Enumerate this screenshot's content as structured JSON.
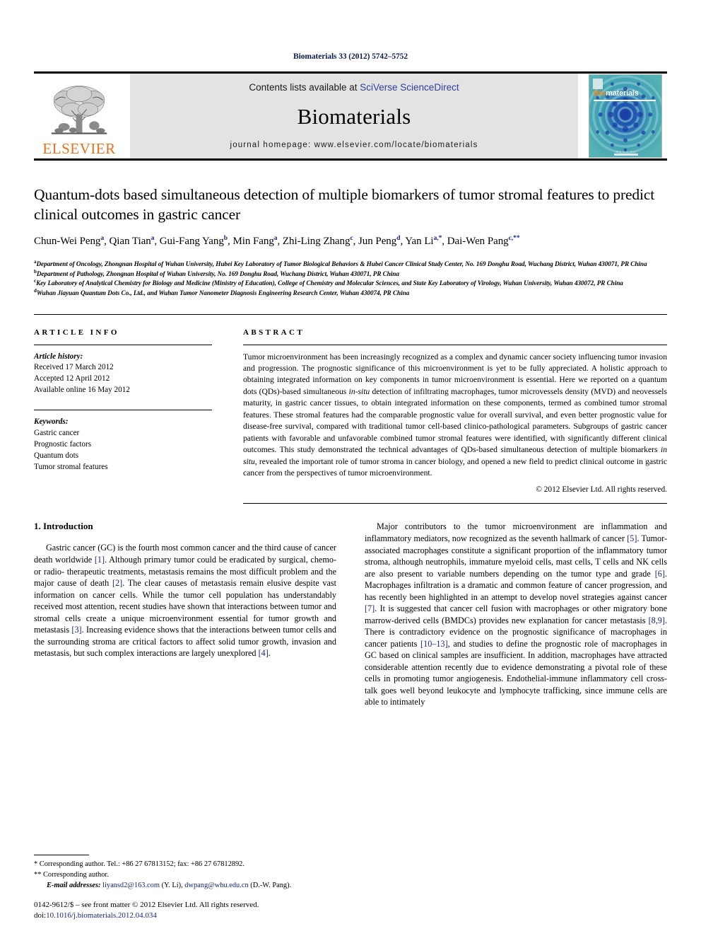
{
  "running_head": "Biomaterials 33 (2012) 5742–5752",
  "masthead": {
    "publisher_name": "ELSEVIER",
    "contents_prefix": "Contents lists available at ",
    "contents_link": "SciVerse ScienceDirect",
    "journal_name": "Biomaterials",
    "homepage": "journal homepage: www.elsevier.com/locate/biomaterials",
    "cover": {
      "title_part1": "Bio",
      "title_part2": "materials",
      "footer_text": "ISSN 0142-9612",
      "bg_color": "#3aa0a8",
      "accent_color": "#f0861e"
    },
    "brand_color": "#E9711C",
    "link_color": "#2c3f9e"
  },
  "article": {
    "title": "Quantum-dots based simultaneous detection of multiple biomarkers of tumor stromal features to predict clinical outcomes in gastric cancer",
    "authors": [
      {
        "name": "Chun-Wei Peng",
        "marks": "a"
      },
      {
        "name": "Qian Tian",
        "marks": "a"
      },
      {
        "name": "Gui-Fang Yang",
        "marks": "b"
      },
      {
        "name": "Min Fang",
        "marks": "a"
      },
      {
        "name": "Zhi-Ling Zhang",
        "marks": "c"
      },
      {
        "name": "Jun Peng",
        "marks": "d"
      },
      {
        "name": "Yan Li",
        "marks": "a,*"
      },
      {
        "name": "Dai-Wen Pang",
        "marks": "c,**"
      }
    ],
    "affiliations": [
      {
        "mark": "a",
        "text": "Department of Oncology, Zhongnan Hospital of Wuhan University, Hubei Key Laboratory of Tumor Biological Behaviors & Hubei Cancer Clinical Study Center, No. 169 Donghu Road, Wuchang District, Wuhan 430071, PR China"
      },
      {
        "mark": "b",
        "text": "Department of Pathology, Zhongnan Hospital of Wuhan University, No. 169 Donghu Road, Wuchang District, Wuhan 430071, PR China"
      },
      {
        "mark": "c",
        "text": "Key Laboratory of Analytical Chemistry for Biology and Medicine (Ministry of Education), College of Chemistry and Molecular Sciences, and State Key Laboratory of Virology, Wuhan University, Wuhan 430072, PR China"
      },
      {
        "mark": "d",
        "text": "Wuhan Jiayuan Quantum Dots Co., Ltd., and Wuhan Tumor Nanometer Diagnosis Engineering Research Center, Wuhan 430074, PR China"
      }
    ]
  },
  "article_info": {
    "heading": "ARTICLE INFO",
    "history_label": "Article history:",
    "history": [
      "Received 17 March 2012",
      "Accepted 12 April 2012",
      "Available online 16 May 2012"
    ],
    "keywords_label": "Keywords:",
    "keywords": [
      "Gastric cancer",
      "Prognostic factors",
      "Quantum dots",
      "Tumor stromal features"
    ]
  },
  "abstract": {
    "heading": "ABSTRACT",
    "p1": "Tumor microenvironment has been increasingly recognized as a complex and dynamic cancer society influencing tumor invasion and progression. The prognostic significance of this microenvironment is yet to be fully appreciated. A holistic approach to obtaining integrated information on key components in tumor microenvironment is essential. Here we reported on a quantum dots (QDs)-based simultaneous ",
    "italic1": "in-situ",
    "p2": " detection of infiltrating macrophages, tumor microvessels density (MVD) and neovessels maturity, in gastric cancer tissues, to obtain integrated information on these components, termed as combined tumor stromal features. These stromal features had the comparable prognostic value for overall survival, and even better prognostic value for disease-free survival, compared with traditional tumor cell-based clinico-pathological parameters. Subgroups of gastric cancer patients with favorable and unfavorable combined tumor stromal features were identified, with significantly different clinical outcomes. This study demonstrated the technical advantages of QDs-based simultaneous detection of multiple biomarkers ",
    "italic2": "in situ",
    "p3": ", revealed the important role of tumor stroma in cancer biology, and opened a new field to predict clinical outcome in gastric cancer from the perspectives of tumor microenvironment.",
    "copyright": "© 2012 Elsevier Ltd. All rights reserved."
  },
  "introduction": {
    "heading": "1. Introduction",
    "left_p1_a": "Gastric cancer (GC) is the fourth most common cancer and the third cause of cancer death worldwide ",
    "left_cite1": "[1]",
    "left_p1_b": ". Although primary tumor could be eradicated by surgical, chemo- or radio- therapeutic treatments, metastasis remains the most difficult problem and the major cause of death ",
    "left_cite2": "[2]",
    "left_p1_c": ". The clear causes of metastasis remain elusive despite vast information on cancer cells. While the tumor cell population has understandably received most attention, recent studies have shown that interactions between tumor and stromal cells create a unique microenvironment essential for tumor growth and metastasis ",
    "left_cite3": "[3]",
    "left_p1_d": ". Increasing evidence shows that the interactions between tumor cells and the surrounding stroma are critical factors to affect solid tumor growth, invasion and metastasis, but such complex interactions are largely unexplored ",
    "left_cite4": "[4]",
    "left_p1_e": ".",
    "right_p1_a": "Major contributors to the tumor microenvironment are inflammation and inflammatory mediators, now recognized as the seventh hallmark of cancer ",
    "right_cite5": "[5]",
    "right_p1_b": ". Tumor-associated macrophages constitute a significant proportion of the inflammatory tumor stroma, although neutrophils, immature myeloid cells, mast cells, T cells and NK cells are also present to variable numbers depending on the tumor type and grade ",
    "right_cite6": "[6]",
    "right_p1_c": ". Macrophages infiltration is a dramatic and common feature of cancer progression, and has recently been highlighted in an attempt to develop novel strategies against cancer ",
    "right_cite7": "[7]",
    "right_p1_d": ". It is suggested that cancer cell fusion with macrophages or other migratory bone marrow-derived cells (BMDCs) provides new explanation for cancer metastasis ",
    "right_cite8": "[8,9]",
    "right_p1_e": ". There is contradictory evidence on the prognostic significance of macrophages in cancer patients ",
    "right_cite9": "[10–13]",
    "right_p1_f": ", and studies to define the prognostic role of macrophages in GC based on clinical samples are insufficient. In addition, macrophages have attracted considerable attention recently due to evidence demonstrating a pivotal role of these cells in promoting tumor angiogenesis. Endothelial-immune inflammatory cell cross-talk goes well beyond leukocyte and lymphocyte trafficking, since immune cells are able to intimately"
  },
  "footnotes": {
    "corr1": "* Corresponding author. Tel.: +86 27 67813152; fax: +86 27 67812892.",
    "corr2": "** Corresponding author.",
    "email_label": "E-mail addresses:",
    "email1": "liyansd2@163.com",
    "email1_owner": "(Y. Li)",
    "email2": "dwpang@whu.edu.cn",
    "email2_owner": "(D.-W. Pang).",
    "issn_line": "0142-9612/$ – see front matter © 2012 Elsevier Ltd. All rights reserved.",
    "doi_prefix": "doi:",
    "doi": "10.1016/j.biomaterials.2012.04.034"
  }
}
